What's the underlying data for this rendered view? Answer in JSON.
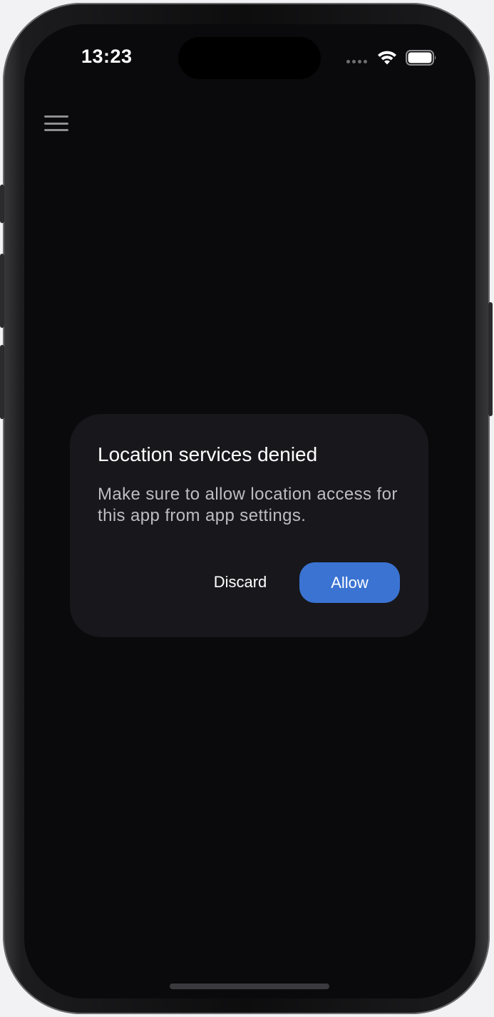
{
  "status_bar": {
    "time": "13:23",
    "icons": [
      "cellular-dots-icon",
      "wifi-icon",
      "battery-icon"
    ]
  },
  "toolbar": {
    "menu_icon": "hamburger-menu-icon"
  },
  "dialog": {
    "title": "Location services denied",
    "message": "Make sure to allow location access for this app from app settings.",
    "discard_label": "Discard",
    "allow_label": "Allow"
  },
  "colors": {
    "background": "#0a0a0c",
    "dialog_background": "#18171c",
    "accent": "#3a73d2",
    "secondary_text": "#bdbdc2"
  }
}
